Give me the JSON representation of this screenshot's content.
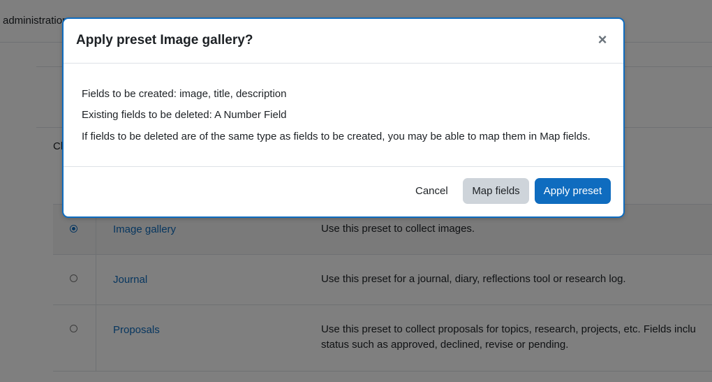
{
  "background": {
    "header_text": "administration",
    "partial_label": "Ch",
    "presets": [
      {
        "name": "Image gallery",
        "description": "Use this preset to collect images.",
        "selected": true
      },
      {
        "name": "Journal",
        "description": "Use this preset for a journal, diary, reflections tool or research log.",
        "selected": false
      },
      {
        "name": "Proposals",
        "description_line1": "Use this preset to collect proposals for topics, research, projects, etc. Fields inclu",
        "description_line2": "status such as approved, declined, revise or pending.",
        "selected": false
      }
    ]
  },
  "modal": {
    "title": "Apply preset Image gallery?",
    "close_icon": "×",
    "lines": [
      "Fields to be created: image, title, description",
      "Existing fields to be deleted: A Number Field",
      "If fields to be deleted are of the same type as fields to be created, you may be able to map them in Map fields."
    ],
    "buttons": {
      "cancel": "Cancel",
      "map_fields": "Map fields",
      "apply": "Apply preset"
    }
  },
  "colors": {
    "primary": "#0f6cbf",
    "secondary": "#ced4da",
    "overlay": "rgba(0,0,0,0.5)"
  }
}
